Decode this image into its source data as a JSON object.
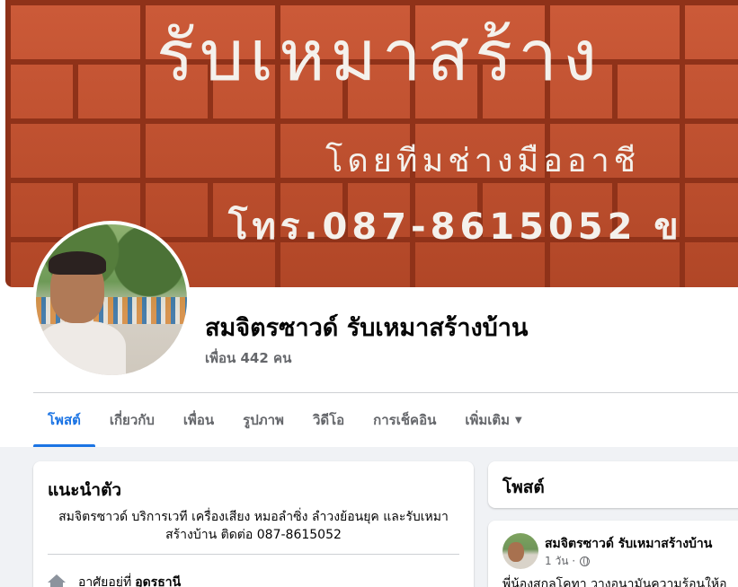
{
  "cover": {
    "line1": "รับเหมาสร้าง",
    "line2": "โดยทีมช่างมืออาชี",
    "line3": "โทร.087-8615052 ข"
  },
  "profile": {
    "name": "สมจิตรซาวด์ รับเหมาสร้างบ้าน",
    "friends": "เพื่อน 442 คน"
  },
  "tabs": [
    {
      "label": "โพสต์",
      "active": true
    },
    {
      "label": "เกี่ยวกับ"
    },
    {
      "label": "เพื่อน"
    },
    {
      "label": "รูปภาพ"
    },
    {
      "label": "วิดีโอ"
    },
    {
      "label": "การเช็คอิน"
    },
    {
      "label": "เพิ่มเติม"
    }
  ],
  "intro": {
    "title": "แนะนำตัว",
    "bio": "สมจิตรซาวด์ บริการเวที เครื่องเสียง หมอลำซิ่ง ลำวงย้อนยุค และรับเหมาสร้างบ้าน ติดต่อ 087-8615052",
    "lives_label": "อาศัยอยู่ที่",
    "lives_city": "อุดรธานี"
  },
  "posts": {
    "title": "โพสต์",
    "first": {
      "author": "สมจิตรซาวด์ รับเหมาสร้างบ้าน",
      "time": "1 วัน ·",
      "text": "พี่น้องสกุลโคทา วางอนามันความร้อนให้อ"
    }
  },
  "colors": {
    "accent": "#1b74e4",
    "secondary_text": "#65676b",
    "background": "#f0f2f5"
  },
  "icons": [
    "home-icon",
    "globe-icon",
    "caret-down-icon"
  ]
}
